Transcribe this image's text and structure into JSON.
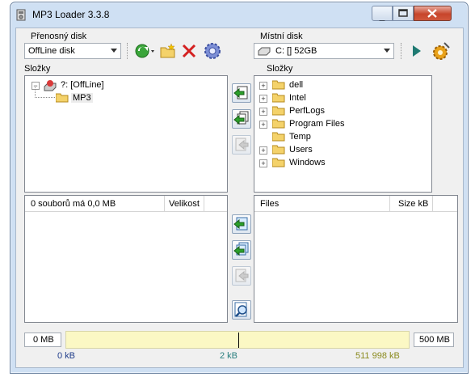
{
  "window": {
    "title": "MP3 Loader 3.3.8"
  },
  "left": {
    "drive_label": "Přenosný disk",
    "drive_value": "OffLine disk",
    "folders_label": "Složky",
    "tree_root": "?: [OffLine]",
    "tree_child": "MP3",
    "files_header_summary": "0 souborů má 0,0 MB",
    "files_header_size": "Velikost"
  },
  "right": {
    "drive_label": "Místní disk",
    "drive_value": "C: []  52GB",
    "folders_label": "Složky",
    "tree": [
      "dell",
      "Intel",
      "PerfLogs",
      "Program Files",
      "Temp",
      "Users",
      "Windows"
    ],
    "files_header_name": "Files",
    "files_header_size": "Size kB"
  },
  "status": {
    "min_label": "0 MB",
    "max_label": "500 MB",
    "used": "0 kB",
    "marker": "2 kB",
    "free": "511 998 kB"
  },
  "colors": {
    "progress_fill": "#fbf8c4",
    "used_color": "#1f3c8a",
    "marker_color": "#2a7f7f",
    "free_color": "#8a8a1e"
  }
}
